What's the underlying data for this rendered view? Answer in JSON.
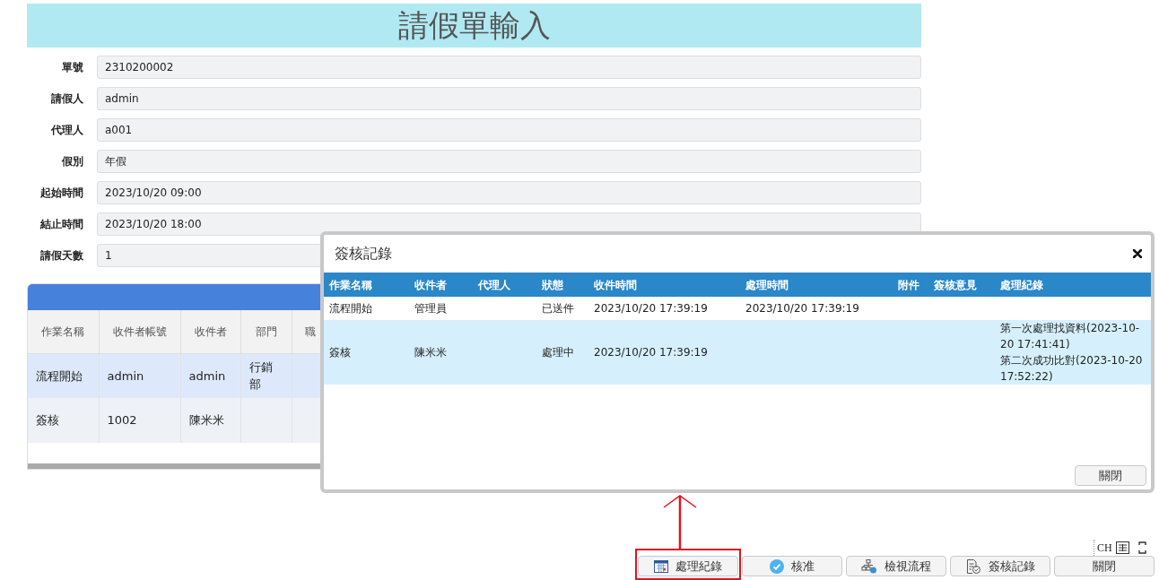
{
  "title": "請假單輸入",
  "form": {
    "fields": [
      {
        "label": "單號",
        "value": "2310200002"
      },
      {
        "label": "請假人",
        "value": "admin"
      },
      {
        "label": "代理人",
        "value": "a001"
      },
      {
        "label": "假別",
        "value": "年假"
      },
      {
        "label": "起始時間",
        "value": "2023/10/20 09:00"
      },
      {
        "label": "結止時間",
        "value": "2023/10/20 18:00"
      },
      {
        "label": "請假天數",
        "value": "1"
      }
    ]
  },
  "grid": {
    "columns": [
      "作業名稱",
      "收件者帳號",
      "收件者",
      "部門",
      "職"
    ],
    "rows": [
      {
        "selected": true,
        "cells": [
          "流程開始",
          "admin",
          "admin",
          "行銷部",
          ""
        ]
      },
      {
        "selected": false,
        "cells": [
          "簽核",
          "1002",
          "陳米米",
          "",
          ""
        ]
      }
    ]
  },
  "dialog": {
    "title": "簽核記錄",
    "columns": [
      "作業名稱",
      "收件者",
      "代理人",
      "狀態",
      "收件時間",
      "處理時間",
      "附件",
      "簽核意見",
      "處理紀錄"
    ],
    "rows": [
      {
        "selected": false,
        "cells": [
          "流程開始",
          "管理員",
          "",
          "已送件",
          "2023/10/20 17:39:19",
          "2023/10/20 17:39:19",
          "",
          "",
          ""
        ]
      },
      {
        "selected": true,
        "cells": [
          "簽核",
          "陳米米",
          "",
          "處理中",
          "2023/10/20 17:39:19",
          "",
          "",
          "",
          "第一次處理找資料(2023-10-20 17:41:41)\n第二次成功比對(2023-10-20 17:52:22)"
        ]
      }
    ],
    "close_button": "關閉"
  },
  "buttons": [
    {
      "label": "處理紀錄",
      "kind": "calendar",
      "highlighted": true
    },
    {
      "label": "核准",
      "kind": "check",
      "highlighted": false
    },
    {
      "label": "檢視流程",
      "kind": "flow",
      "highlighted": false
    },
    {
      "label": "簽核記錄",
      "kind": "document",
      "highlighted": false
    },
    {
      "label": "關閉",
      "kind": "plain",
      "highlighted": false
    }
  ],
  "ime": {
    "label": "CH"
  }
}
